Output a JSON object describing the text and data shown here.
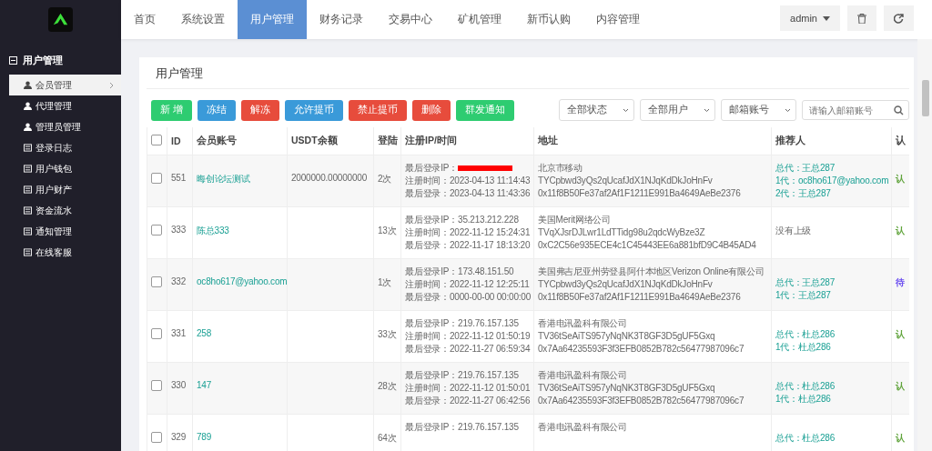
{
  "nav": {
    "tabs": [
      {
        "label": "首页",
        "selected": false
      },
      {
        "label": "系统设置",
        "selected": false
      },
      {
        "label": "用户管理",
        "selected": true
      },
      {
        "label": "财务记录",
        "selected": false
      },
      {
        "label": "交易中心",
        "selected": false
      },
      {
        "label": "矿机管理",
        "selected": false
      },
      {
        "label": "新币认购",
        "selected": false
      },
      {
        "label": "内容管理",
        "selected": false
      }
    ],
    "user": "admin"
  },
  "sidebar": {
    "group": {
      "label": "用户管理",
      "expanded": true
    },
    "items": [
      {
        "label": "会员管理",
        "kind": "user",
        "selected": true
      },
      {
        "label": "代理管理",
        "kind": "user",
        "selected": false
      },
      {
        "label": "管理员管理",
        "kind": "user",
        "selected": false
      },
      {
        "label": "登录日志",
        "kind": "list",
        "selected": false
      },
      {
        "label": "用户钱包",
        "kind": "list",
        "selected": false
      },
      {
        "label": "用户财产",
        "kind": "list",
        "selected": false
      },
      {
        "label": "资金流水",
        "kind": "list",
        "selected": false
      },
      {
        "label": "通知管理",
        "kind": "list",
        "selected": false
      },
      {
        "label": "在线客服",
        "kind": "list",
        "selected": false
      }
    ]
  },
  "panel": {
    "title": "用户管理",
    "buttons": [
      {
        "label": "新 增",
        "kind": "success"
      },
      {
        "label": "冻结",
        "kind": "primary"
      },
      {
        "label": "解冻",
        "kind": "danger"
      },
      {
        "label": "允许提币",
        "kind": "primary"
      },
      {
        "label": "禁止提币",
        "kind": "danger"
      },
      {
        "label": "删除",
        "kind": "danger"
      },
      {
        "label": "群发通知",
        "kind": "success"
      }
    ],
    "filters": [
      "全部状态",
      "全部用户",
      "邮箱账号"
    ],
    "search": {
      "placeholder": "请输入邮箱账号"
    }
  },
  "table": {
    "all_checked": false,
    "columns": [
      "ID",
      "会员账号",
      "USDT余额",
      "登陆",
      "注册IP/时间",
      "地址",
      "推荐人",
      "认"
    ],
    "rows": [
      {
        "checked": false,
        "id": "551",
        "account": "晦创论坛测试",
        "balance": "2000000.00000000",
        "logins": "2次",
        "redacted": true,
        "login_info": [
          "最后登录IP：",
          "注册时间：2023-04-13 11:14:43",
          "最后登录：2023-04-13 11:43:36"
        ],
        "address": [
          "北京市移动",
          "TYCpbwd3yQs2qUcafJdX1NJqKdDkJoHnFv",
          "0x11f8B50Fe37af2Af1F1211E991Ba4649AeBe2376"
        ],
        "referrer": [
          {
            "text": "总代：王总287",
            "kind": "link"
          },
          {
            "text": "1代：oc8ho617@yahoo.com",
            "kind": "link"
          },
          {
            "text": "2代：王总287",
            "kind": "link"
          }
        ],
        "status": {
          "text": "认",
          "color": "#5fa33a"
        }
      },
      {
        "checked": false,
        "id": "333",
        "account": "陈总333",
        "logins": "13次",
        "login_info": [
          "最后登录IP：35.213.212.228",
          "注册时间：2022-11-12 15:24:31",
          "最后登录：2022-11-17 18:13:20"
        ],
        "address": [
          "美国Merit网络公司",
          "TVqXJsrDJLwr1LdTTidg98u2qdcWyBze3Z",
          "0xC2C56e935ECE4c1C45443EE6a881bfD9C4B45AD4"
        ],
        "referrer": [
          {
            "text": "没有上级",
            "kind": "plain"
          }
        ],
        "status": {
          "text": "认",
          "color": "#5fa33a"
        }
      },
      {
        "checked": false,
        "id": "332",
        "account": "oc8ho617@yahoo.com",
        "logins": "1次",
        "login_info": [
          "最后登录IP：173.48.151.50",
          "注册时间：2022-11-12 12:25:11",
          "最后登录：0000-00-00 00:00:00"
        ],
        "address": [
          "美国弗吉尼亚州劳登县阿什本地区Verizon Online有限公司",
          "TYCpbwd3yQs2qUcafJdX1NJqKdDkJoHnFv",
          "0x11f8B50Fe37af2Af1F1211E991Ba4649AeBe2376"
        ],
        "referrer": [
          {
            "text": "总代：王总287",
            "kind": "link"
          },
          {
            "text": "1代：王总287",
            "kind": "link"
          }
        ],
        "status": {
          "text": "待",
          "color": "#6a4cf0"
        }
      },
      {
        "checked": false,
        "id": "331",
        "account": "258",
        "logins": "33次",
        "login_info": [
          "最后登录IP：219.76.157.135",
          "注册时间：2022-11-12 01:50:19",
          "最后登录：2022-11-27 06:59:34"
        ],
        "address": [
          "香港电讯盈科有限公司",
          "TV36tSeAiTS957yNqNK3T8GF3D5gUF5Gxq",
          "0x7Aa64235593F3f3EFB0852B782c56477987096c7"
        ],
        "referrer": [
          {
            "text": "总代：杜总286",
            "kind": "link"
          },
          {
            "text": "1代：杜总286",
            "kind": "link"
          }
        ],
        "status": {
          "text": "认",
          "color": "#5fa33a"
        }
      },
      {
        "checked": false,
        "id": "330",
        "account": "147",
        "logins": "28次",
        "login_info": [
          "最后登录IP：219.76.157.135",
          "注册时间：2022-11-12 01:50:01",
          "最后登录：2022-11-27 06:42:56"
        ],
        "address": [
          "香港电讯盈科有限公司",
          "TV36tSeAiTS957yNqNK3T8GF3D5gUF5Gxq",
          "0x7Aa64235593F3f3EFB0852B782c56477987096c7"
        ],
        "referrer": [
          {
            "text": "总代：杜总286",
            "kind": "link"
          },
          {
            "text": "1代：杜总286",
            "kind": "link"
          }
        ],
        "status": {
          "text": "认",
          "color": "#5fa33a"
        }
      },
      {
        "checked": false,
        "id": "329",
        "account": "789",
        "logins": "64次",
        "login_info": [
          "最后登录IP：219.76.157.135"
        ],
        "address": [
          "香港电讯盈科有限公司"
        ],
        "referrer": [
          {
            "text": "总代：杜总286",
            "kind": "link"
          }
        ],
        "status": {
          "text": "认",
          "color": "#5fa33a"
        }
      }
    ]
  }
}
